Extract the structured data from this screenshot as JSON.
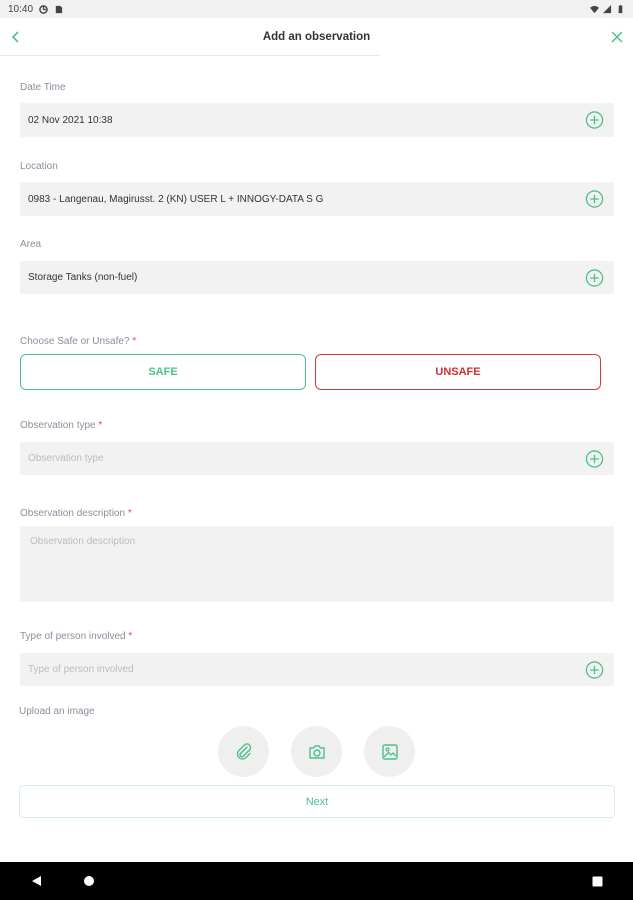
{
  "status_bar": {
    "time": "10:40"
  },
  "header": {
    "title": "Add an observation"
  },
  "fields": {
    "date_time": {
      "label": "Date Time",
      "value": "02 Nov 2021 10:38"
    },
    "location": {
      "label": "Location",
      "value": "0983 - Langenau, Magirusst. 2 (KN) USER L + INNOGY-DATA S G"
    },
    "area": {
      "label": "Area",
      "value": "Storage Tanks (non-fuel)"
    },
    "safe_unsafe": {
      "label": "Choose Safe or Unsafe?",
      "required_mark": "*",
      "safe_label": "SAFE",
      "unsafe_label": "UNSAFE"
    },
    "observation_type": {
      "label": "Observation type",
      "required_mark": "*",
      "placeholder": "Observation type"
    },
    "observation_description": {
      "label": "Observation description",
      "required_mark": "*",
      "placeholder": "Observation description"
    },
    "person_type": {
      "label": "Type of person involved",
      "required_mark": "*",
      "placeholder": "Type of person involved"
    }
  },
  "upload": {
    "label": "Upload an image",
    "buttons": [
      "paperclip-icon",
      "camera-icon",
      "image-icon"
    ]
  },
  "next_label": "Next",
  "colors": {
    "accent": "#4ec18d",
    "danger": "#d12e2e",
    "field_bg": "#f2f2f2",
    "label": "#8a8f9c"
  }
}
